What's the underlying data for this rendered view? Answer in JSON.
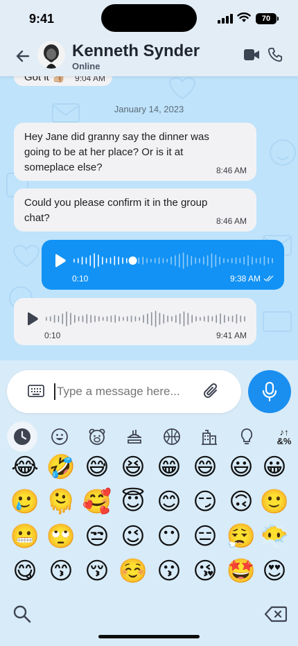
{
  "status_bar": {
    "time": "9:41",
    "battery": "70"
  },
  "header": {
    "name": "Kenneth Synder",
    "status": "Online"
  },
  "chat": {
    "partial_message": {
      "text": "Got it 👍🏼",
      "time": "9:04 AM"
    },
    "date_separator": "January 14, 2023",
    "messages": [
      {
        "text": "Hey Jane did granny say the dinner was going to be at her place? Or is it at someplace else?",
        "time": "8:46 AM"
      },
      {
        "text": "Could you please confirm it in the group chat?",
        "time": "8:46 AM"
      }
    ],
    "voice_outgoing": {
      "duration": "0:10",
      "time": "9:38 AM",
      "progress": 0.3
    },
    "voice_incoming": {
      "duration": "0:10",
      "time": "9:41 AM"
    }
  },
  "composer": {
    "placeholder": "Type a message here..."
  },
  "emoji_keyboard": {
    "active_category": "recent",
    "categories": [
      "recent",
      "smileys",
      "animals",
      "food",
      "activity",
      "travel",
      "objects",
      "symbols"
    ],
    "symbols_label": "&%",
    "emojis": [
      [
        "😂",
        "🤣",
        "😅",
        "😆",
        "😁",
        "😄",
        "😃",
        "😀"
      ],
      [
        "🥲",
        "🫠",
        "🥰",
        "😇",
        "😊",
        "😏",
        "🙃",
        "🙂"
      ],
      [
        "😬",
        "🙄",
        "😒",
        "😉",
        "😶",
        "😑",
        "😮‍💨",
        "😶‍🌫️"
      ],
      [
        "😋",
        "😙",
        "😚",
        "☺️",
        "😗",
        "😘",
        "🤩",
        "😍"
      ]
    ]
  },
  "colors": {
    "accent": "#1292f4",
    "chat_bg": "#bfe3fb",
    "bubble": "#f2f2f4"
  }
}
